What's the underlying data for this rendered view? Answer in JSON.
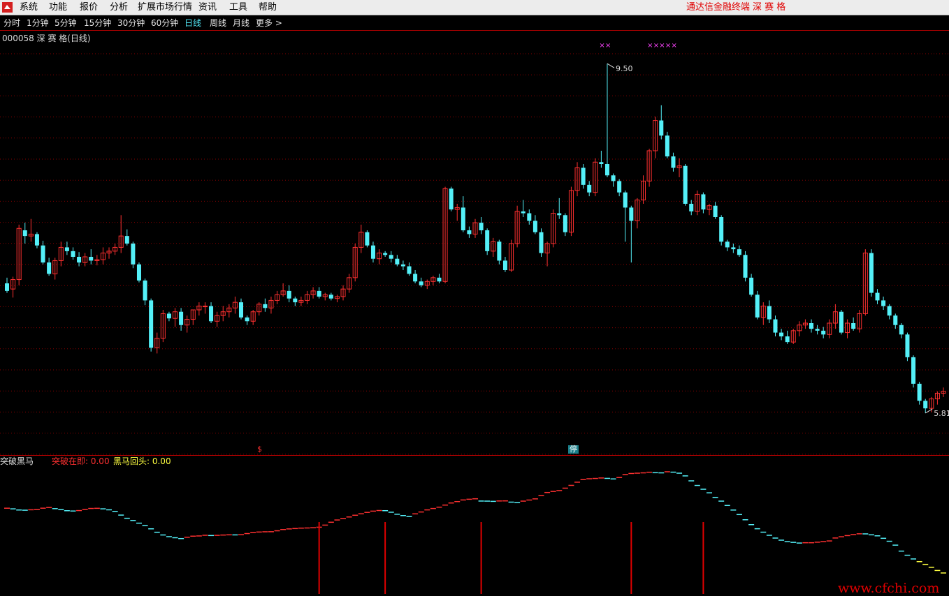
{
  "menu": {
    "items": [
      "系统",
      "功能",
      "报价",
      "分析",
      "扩展市场行情",
      "资讯",
      "工具",
      "帮助"
    ],
    "brand": "通达信金融终端",
    "stock_name_title": "深 赛 格"
  },
  "periods": {
    "items": [
      "分时",
      "1分钟",
      "5分钟",
      "15分钟",
      "30分钟",
      "60分钟",
      "日线",
      "周线",
      "月线",
      "更多 >"
    ],
    "active_index": 6
  },
  "stock": {
    "title": "000058 深 赛 格(日线)",
    "high_label": "9.50",
    "low_label": "5.81"
  },
  "markers": {
    "s": "$",
    "ting": "停"
  },
  "indicator": {
    "name": "突破黑马",
    "line1": "突破在即: 0.00",
    "line2": "黑马回头: 0.00"
  },
  "watermark": "www.cfchi.com",
  "colors": {
    "up": "#ff3030",
    "down": "#54f0f8",
    "grid": "#8a0000",
    "marker": "#ff44ff",
    "yellow": "#ffff40"
  },
  "chart_data": {
    "type": "candlestick",
    "title": "000058 深 赛 格(日线)",
    "ylim": [
      5.5,
      9.7
    ],
    "annotations": [
      {
        "label": "9.50",
        "value": 9.5
      },
      {
        "label": "5.81",
        "value": 5.81
      }
    ],
    "ohlc": [
      [
        7.18,
        7.24,
        7.08,
        7.1
      ],
      [
        7.12,
        7.25,
        7.03,
        7.22
      ],
      [
        7.22,
        7.8,
        7.16,
        7.76
      ],
      [
        7.74,
        7.82,
        7.6,
        7.68
      ],
      [
        7.68,
        7.86,
        7.62,
        7.7
      ],
      [
        7.7,
        7.72,
        7.55,
        7.58
      ],
      [
        7.58,
        7.63,
        7.38,
        7.4
      ],
      [
        7.4,
        7.45,
        7.26,
        7.28
      ],
      [
        7.28,
        7.45,
        7.22,
        7.42
      ],
      [
        7.42,
        7.62,
        7.36,
        7.56
      ],
      [
        7.56,
        7.62,
        7.48,
        7.52
      ],
      [
        7.52,
        7.56,
        7.43,
        7.46
      ],
      [
        7.46,
        7.51,
        7.36,
        7.4
      ],
      [
        7.4,
        7.5,
        7.36,
        7.46
      ],
      [
        7.46,
        7.54,
        7.38,
        7.42
      ],
      [
        7.42,
        7.48,
        7.37,
        7.43
      ],
      [
        7.43,
        7.56,
        7.38,
        7.5
      ],
      [
        7.5,
        7.56,
        7.44,
        7.52
      ],
      [
        7.52,
        7.6,
        7.48,
        7.56
      ],
      [
        7.56,
        7.9,
        7.5,
        7.68
      ],
      [
        7.68,
        7.75,
        7.58,
        7.6
      ],
      [
        7.6,
        7.62,
        7.34,
        7.38
      ],
      [
        7.38,
        7.4,
        7.19,
        7.21
      ],
      [
        7.21,
        7.23,
        6.95,
        7.0
      ],
      [
        7.0,
        7.02,
        6.46,
        6.5
      ],
      [
        6.5,
        6.66,
        6.44,
        6.6
      ],
      [
        6.6,
        6.9,
        6.56,
        6.86
      ],
      [
        6.86,
        6.88,
        6.78,
        6.81
      ],
      [
        6.81,
        6.92,
        6.72,
        6.88
      ],
      [
        6.88,
        6.92,
        6.68,
        6.74
      ],
      [
        6.74,
        6.84,
        6.66,
        6.8
      ],
      [
        6.8,
        6.9,
        6.74,
        6.9
      ],
      [
        6.9,
        6.98,
        6.84,
        6.94
      ],
      [
        6.94,
        6.98,
        6.86,
        6.94
      ],
      [
        6.94,
        6.98,
        6.76,
        6.78
      ],
      [
        6.78,
        6.88,
        6.72,
        6.84
      ],
      [
        6.84,
        6.94,
        6.78,
        6.88
      ],
      [
        6.88,
        6.96,
        6.82,
        6.92
      ],
      [
        6.92,
        7.04,
        6.86,
        6.98
      ],
      [
        6.98,
        7.02,
        6.8,
        6.82
      ],
      [
        6.82,
        6.84,
        6.74,
        6.78
      ],
      [
        6.78,
        6.9,
        6.74,
        6.88
      ],
      [
        6.88,
        6.98,
        6.84,
        6.96
      ],
      [
        6.96,
        7.02,
        6.88,
        6.92
      ],
      [
        6.92,
        7.04,
        6.86,
        7.0
      ],
      [
        7.0,
        7.1,
        6.96,
        7.06
      ],
      [
        7.06,
        7.18,
        7.04,
        7.1
      ],
      [
        7.1,
        7.16,
        6.98,
        7.02
      ],
      [
        7.02,
        7.04,
        6.94,
        6.98
      ],
      [
        6.98,
        7.04,
        6.94,
        7.0
      ],
      [
        7.0,
        7.1,
        6.96,
        7.06
      ],
      [
        7.06,
        7.14,
        7.02,
        7.1
      ],
      [
        7.1,
        7.14,
        7.02,
        7.04
      ],
      [
        7.04,
        7.08,
        7.0,
        7.06
      ],
      [
        7.06,
        7.08,
        7.0,
        7.02
      ],
      [
        7.02,
        7.06,
        6.98,
        7.04
      ],
      [
        7.04,
        7.16,
        7.0,
        7.12
      ],
      [
        7.12,
        7.28,
        7.08,
        7.24
      ],
      [
        7.24,
        7.6,
        7.2,
        7.56
      ],
      [
        7.56,
        7.8,
        7.5,
        7.72
      ],
      [
        7.72,
        7.74,
        7.56,
        7.58
      ],
      [
        7.58,
        7.62,
        7.4,
        7.44
      ],
      [
        7.44,
        7.54,
        7.38,
        7.5
      ],
      [
        7.5,
        7.52,
        7.46,
        7.48
      ],
      [
        7.48,
        7.52,
        7.4,
        7.44
      ],
      [
        7.44,
        7.48,
        7.36,
        7.38
      ],
      [
        7.38,
        7.42,
        7.32,
        7.36
      ],
      [
        7.36,
        7.4,
        7.26,
        7.28
      ],
      [
        7.28,
        7.32,
        7.18,
        7.2
      ],
      [
        7.2,
        7.24,
        7.14,
        7.16
      ],
      [
        7.16,
        7.22,
        7.12,
        7.2
      ],
      [
        7.2,
        7.26,
        7.16,
        7.24
      ],
      [
        7.24,
        7.28,
        7.18,
        7.2
      ],
      [
        7.2,
        8.2,
        7.18,
        8.18
      ],
      [
        8.18,
        8.2,
        7.94,
        7.96
      ],
      [
        7.96,
        8.02,
        7.84,
        7.98
      ],
      [
        7.98,
        8.1,
        7.72,
        7.74
      ],
      [
        7.74,
        7.78,
        7.66,
        7.7
      ],
      [
        7.7,
        7.86,
        7.66,
        7.82
      ],
      [
        7.82,
        7.88,
        7.7,
        7.74
      ],
      [
        7.74,
        7.76,
        7.48,
        7.52
      ],
      [
        7.52,
        7.66,
        7.46,
        7.62
      ],
      [
        7.62,
        7.64,
        7.38,
        7.42
      ],
      [
        7.42,
        7.46,
        7.3,
        7.32
      ],
      [
        7.32,
        7.64,
        7.3,
        7.6
      ],
      [
        7.6,
        8.0,
        7.56,
        7.94
      ],
      [
        7.94,
        8.06,
        7.88,
        7.92
      ],
      [
        7.92,
        7.96,
        7.8,
        7.84
      ],
      [
        7.84,
        7.9,
        7.7,
        7.72
      ],
      [
        7.72,
        7.76,
        7.46,
        7.5
      ],
      [
        7.5,
        7.62,
        7.36,
        7.6
      ],
      [
        7.6,
        7.96,
        7.56,
        7.92
      ],
      [
        7.92,
        8.08,
        7.86,
        7.9
      ],
      [
        7.9,
        7.92,
        7.68,
        7.72
      ],
      [
        7.72,
        8.2,
        7.68,
        8.16
      ],
      [
        8.16,
        8.46,
        8.1,
        8.4
      ],
      [
        8.4,
        8.44,
        8.18,
        8.22
      ],
      [
        8.22,
        8.26,
        8.1,
        8.14
      ],
      [
        8.14,
        8.5,
        8.1,
        8.46
      ],
      [
        8.46,
        8.58,
        8.4,
        8.44
      ],
      [
        8.44,
        9.5,
        8.3,
        8.32
      ],
      [
        8.32,
        8.34,
        8.2,
        8.26
      ],
      [
        8.26,
        8.28,
        8.1,
        8.14
      ],
      [
        8.14,
        8.16,
        7.62,
        7.98
      ],
      [
        7.98,
        8.0,
        7.4,
        7.84
      ],
      [
        7.84,
        8.08,
        7.76,
        8.06
      ],
      [
        8.06,
        8.32,
        8.02,
        8.26
      ],
      [
        8.26,
        8.6,
        8.2,
        8.58
      ],
      [
        8.58,
        8.94,
        8.5,
        8.9
      ],
      [
        8.9,
        9.06,
        8.7,
        8.74
      ],
      [
        8.74,
        8.78,
        8.5,
        8.52
      ],
      [
        8.52,
        8.56,
        8.36,
        8.4
      ],
      [
        8.4,
        8.5,
        8.3,
        8.42
      ],
      [
        8.42,
        8.44,
        8.0,
        8.02
      ],
      [
        8.02,
        8.06,
        7.9,
        7.94
      ],
      [
        7.94,
        8.16,
        7.9,
        8.12
      ],
      [
        8.12,
        8.14,
        7.92,
        7.96
      ],
      [
        7.96,
        8.02,
        7.9,
        8.0
      ],
      [
        8.0,
        8.04,
        7.86,
        7.88
      ],
      [
        7.88,
        7.9,
        7.58,
        7.62
      ],
      [
        7.62,
        7.64,
        7.52,
        7.56
      ],
      [
        7.56,
        7.6,
        7.5,
        7.54
      ],
      [
        7.54,
        7.58,
        7.46,
        7.48
      ],
      [
        7.48,
        7.52,
        7.2,
        7.24
      ],
      [
        7.24,
        7.28,
        7.04,
        7.06
      ],
      [
        7.06,
        7.1,
        6.8,
        6.82
      ],
      [
        6.82,
        6.98,
        6.74,
        6.94
      ],
      [
        6.94,
        7.0,
        6.76,
        6.8
      ],
      [
        6.8,
        6.84,
        6.62,
        6.66
      ],
      [
        6.66,
        6.7,
        6.58,
        6.62
      ],
      [
        6.62,
        6.68,
        6.54,
        6.56
      ],
      [
        6.56,
        6.7,
        6.54,
        6.68
      ],
      [
        6.68,
        6.78,
        6.62,
        6.74
      ],
      [
        6.74,
        6.8,
        6.7,
        6.76
      ],
      [
        6.76,
        6.8,
        6.66,
        6.7
      ],
      [
        6.7,
        6.74,
        6.64,
        6.68
      ],
      [
        6.68,
        6.72,
        6.6,
        6.64
      ],
      [
        6.64,
        6.8,
        6.6,
        6.76
      ],
      [
        6.76,
        6.96,
        6.7,
        6.88
      ],
      [
        6.88,
        6.9,
        6.64,
        6.66
      ],
      [
        6.66,
        6.8,
        6.6,
        6.76
      ],
      [
        6.76,
        6.82,
        6.68,
        6.7
      ],
      [
        6.7,
        6.9,
        6.66,
        6.86
      ],
      [
        6.86,
        7.54,
        6.84,
        7.5
      ],
      [
        7.5,
        7.54,
        7.04,
        7.08
      ],
      [
        7.08,
        7.12,
        6.96,
        7.0
      ],
      [
        7.0,
        7.04,
        6.9,
        6.94
      ],
      [
        6.94,
        6.96,
        6.8,
        6.84
      ],
      [
        6.84,
        6.86,
        6.7,
        6.74
      ],
      [
        6.74,
        6.76,
        6.6,
        6.64
      ],
      [
        6.64,
        6.66,
        6.36,
        6.4
      ],
      [
        6.4,
        6.42,
        6.08,
        6.12
      ],
      [
        6.12,
        6.14,
        5.9,
        5.94
      ],
      [
        5.94,
        5.96,
        5.81,
        5.86
      ],
      [
        5.86,
        5.98,
        5.82,
        5.96
      ],
      [
        5.96,
        6.04,
        5.9,
        6.02
      ],
      [
        6.02,
        6.08,
        5.98,
        6.04
      ]
    ],
    "signal_bars_index": [
      52,
      63,
      79,
      104,
      116
    ]
  }
}
